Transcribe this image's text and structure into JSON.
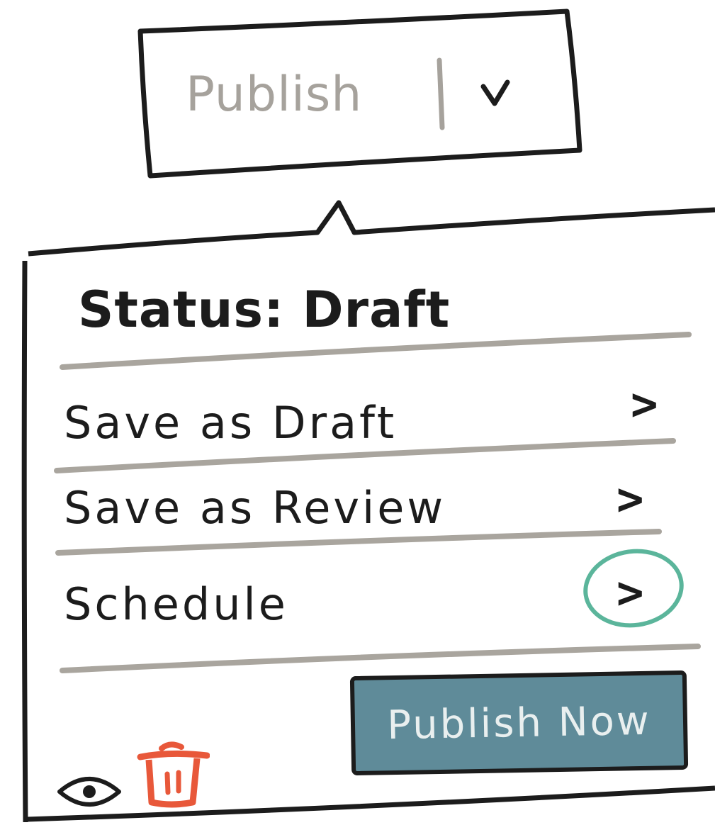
{
  "publish_button": {
    "label": "Publish",
    "dropdown_icon": "chevron-down-icon"
  },
  "dropdown": {
    "status_label": "Status: Draft",
    "items": [
      {
        "label": "Save as Draft",
        "icon": "chevron-right-icon"
      },
      {
        "label": "Save as Review",
        "icon": "chevron-right-icon"
      },
      {
        "label": "Schedule",
        "icon": "chevron-right-icon",
        "highlighted": true
      }
    ],
    "publish_now_label": "Publish Now",
    "footer_icons": [
      "eye-icon",
      "trash-icon"
    ]
  },
  "colors": {
    "ink": "#1c1c1c",
    "muted_text": "#a6a29c",
    "divider": "#a9a59e",
    "highlight_circle": "#5bb59b",
    "publish_now_bg": "#5f8b99",
    "trash_icon": "#e8583a"
  }
}
